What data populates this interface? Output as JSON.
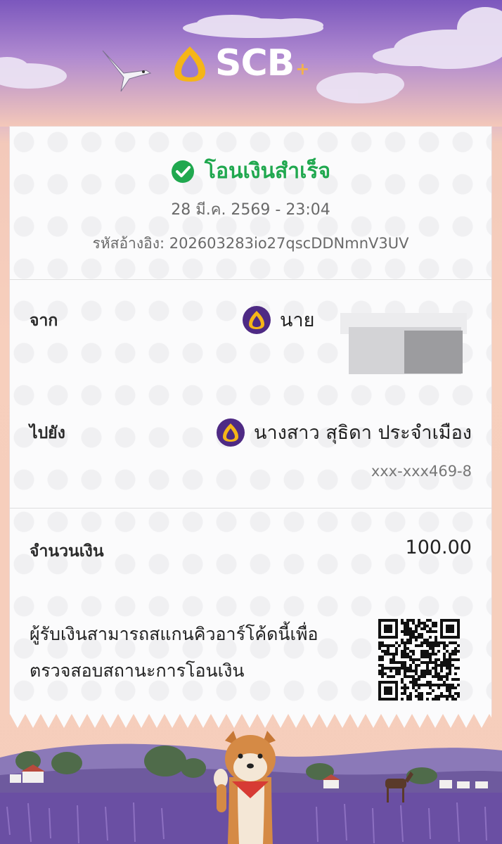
{
  "brand": {
    "name": "SCB",
    "plus": "+"
  },
  "status": {
    "text": "โอนเงินสำเร็จ"
  },
  "datetime": "28 มี.ค. 2569 - 23:04",
  "reference": {
    "label": "รหัสอ้างอิง:",
    "value": "202603283io27qscDDNmnV3UV"
  },
  "from": {
    "label": "จาก",
    "name": "นาย"
  },
  "to": {
    "label": "ไปยัง",
    "name": "นางสาว สุธิดา ประจำเมือง",
    "account": "xxx-xxx469-8"
  },
  "amount": {
    "label": "จำนวนเงิน",
    "value": "100.00"
  },
  "qr": {
    "line1": "ผู้รับเงินสามารถสแกนคิวอาร์โค้ดนี้เพื่อ",
    "line2": "ตรวจสอบสถานะการโอนเงิน"
  },
  "colors": {
    "success": "#20a84f",
    "brand_purple": "#4e2a84",
    "brand_gold": "#f5b517"
  },
  "icons": [
    "scb-logo-icon",
    "bird-icon",
    "check-circle-icon",
    "scb-bank-icon",
    "qr-code-icon",
    "shiba-dog-illustration"
  ]
}
